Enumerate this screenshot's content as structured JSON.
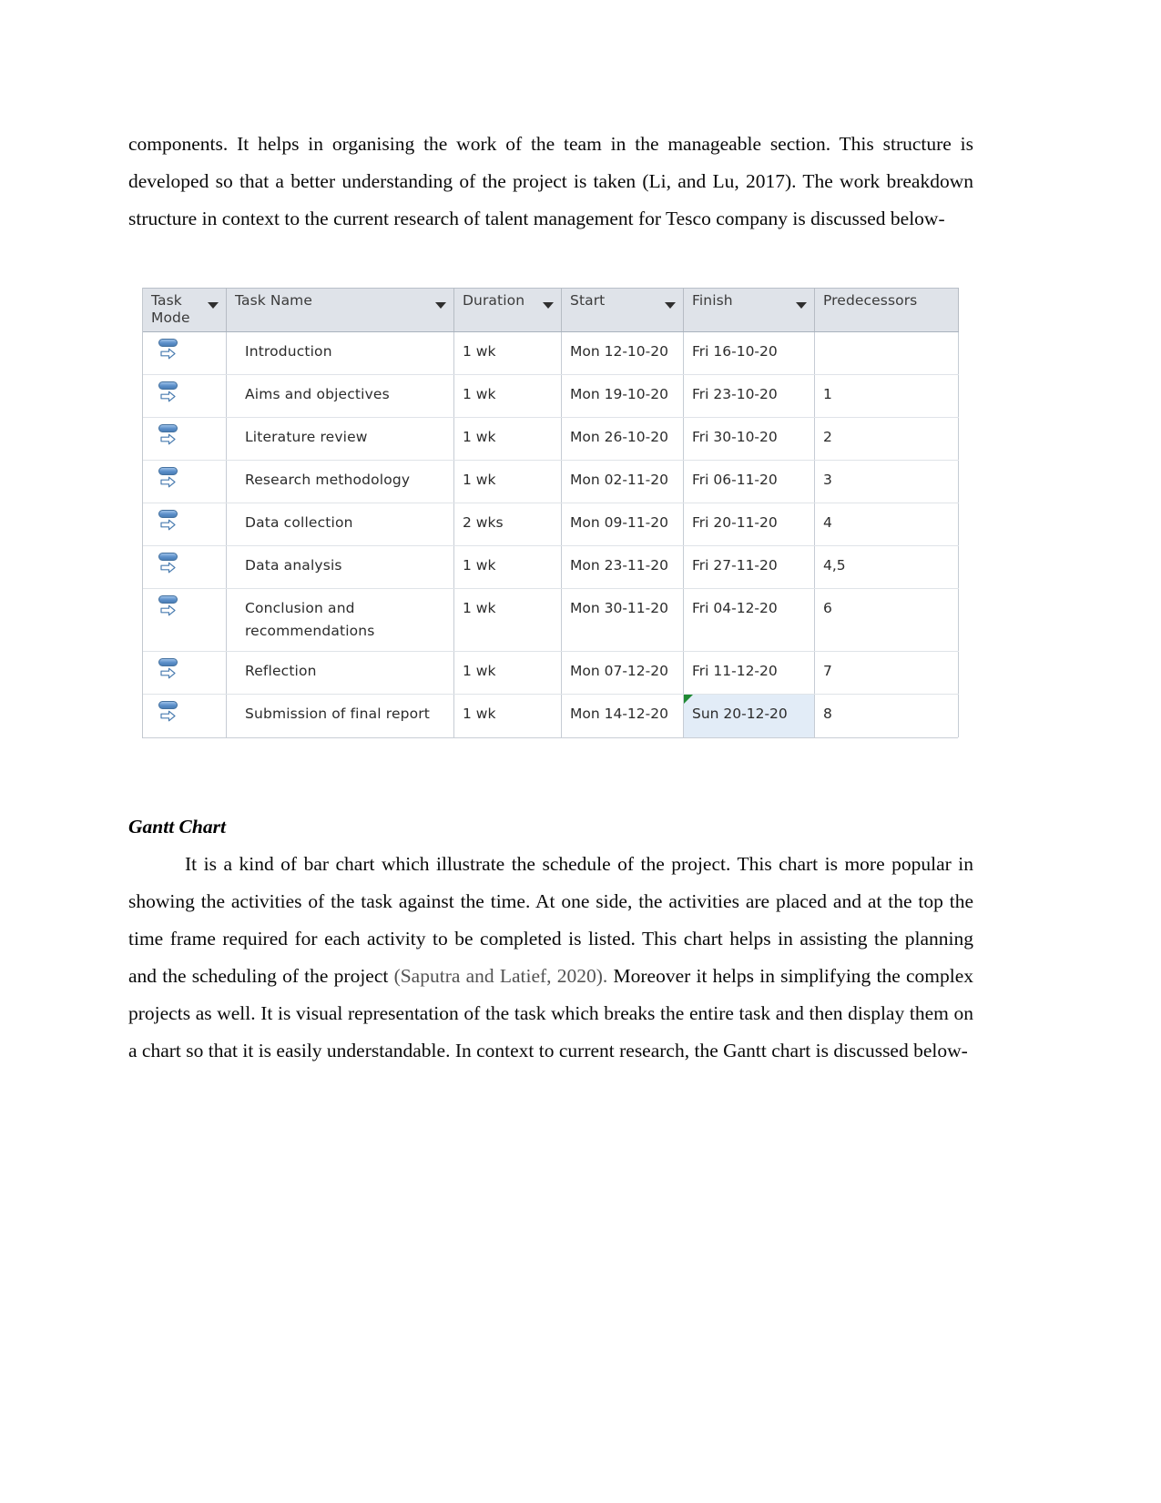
{
  "document": {
    "paragraph_top": "components. It helps in organising the work of the team in the manageable section. This structure is developed so that a better understanding of the project is taken  (Li, and Lu, 2017). The work breakdown structure in context to the current research of talent management for Tesco company is discussed below-",
    "heading_gantt": "Gantt Chart",
    "paragraph_gantt_before_cite": "It is a kind of bar chart which illustrate the schedule of the project. This chart is more popular in showing the activities of the task against the time. At one side, the activities are placed and at the top the time frame required for each activity to be completed is listed. This chart helps in assisting the planning and the scheduling of the project ",
    "paragraph_gantt_cite": "(Saputra and Latief, 2020).",
    "paragraph_gantt_after_cite": " Moreover it helps in simplifying the complex projects as well. It is visual representation of the task which breaks the entire task and then display them on a chart so that it is easily understandable. In context to current research, the Gantt chart is discussed below-"
  },
  "project_table": {
    "columns": [
      {
        "key": "task_mode",
        "label": "Task\nMode",
        "has_filter": true,
        "highlighted": false
      },
      {
        "key": "task_name",
        "label": "Task Name",
        "has_filter": true,
        "highlighted": false
      },
      {
        "key": "duration",
        "label": "Duration",
        "has_filter": true,
        "highlighted": false
      },
      {
        "key": "start",
        "label": "Start",
        "has_filter": true,
        "highlighted": false
      },
      {
        "key": "finish",
        "label": "Finish",
        "has_filter": true,
        "highlighted": false
      },
      {
        "key": "predecessors",
        "label": "Predecessors",
        "has_filter": true,
        "highlighted": true
      }
    ],
    "header_accent_color": "#fcd960",
    "selected_cell_color": "#e2ecf7",
    "flag_color": "#1f8a33",
    "rows": [
      {
        "mode_icon": "auto-scheduled-icon",
        "task_name": "Introduction",
        "duration": "1 wk",
        "start": "Mon 12-10-20",
        "finish": "Fri 16-10-20",
        "predecessors": ""
      },
      {
        "mode_icon": "auto-scheduled-icon",
        "task_name": "Aims and objectives",
        "duration": "1 wk",
        "start": "Mon 19-10-20",
        "finish": "Fri 23-10-20",
        "predecessors": "1"
      },
      {
        "mode_icon": "auto-scheduled-icon",
        "task_name": "Literature review",
        "duration": "1 wk",
        "start": "Mon 26-10-20",
        "finish": "Fri 30-10-20",
        "predecessors": "2"
      },
      {
        "mode_icon": "auto-scheduled-icon",
        "task_name": "Research methodology",
        "duration": "1 wk",
        "start": "Mon 02-11-20",
        "finish": "Fri 06-11-20",
        "predecessors": "3"
      },
      {
        "mode_icon": "auto-scheduled-icon",
        "task_name": "Data collection",
        "duration": "2 wks",
        "start": "Mon 09-11-20",
        "finish": "Fri 20-11-20",
        "predecessors": "4"
      },
      {
        "mode_icon": "auto-scheduled-icon",
        "task_name": "Data analysis",
        "duration": "1 wk",
        "start": "Mon 23-11-20",
        "finish": "Fri 27-11-20",
        "predecessors": "4,5"
      },
      {
        "mode_icon": "auto-scheduled-icon",
        "task_name": "Conclusion and recommendations",
        "duration": "1 wk",
        "start": "Mon 30-11-20",
        "finish": "Fri 04-12-20",
        "predecessors": "6"
      },
      {
        "mode_icon": "auto-scheduled-icon",
        "task_name": "Reflection",
        "duration": "1 wk",
        "start": "Mon 07-12-20",
        "finish": "Fri 11-12-20",
        "predecessors": "7"
      },
      {
        "mode_icon": "auto-scheduled-icon",
        "task_name": "Submission of final report",
        "duration": "1 wk",
        "start": "Mon 14-12-20",
        "finish": "Sun 20-12-20",
        "predecessors": "8",
        "finish_selected": true,
        "finish_flag": true
      }
    ]
  }
}
